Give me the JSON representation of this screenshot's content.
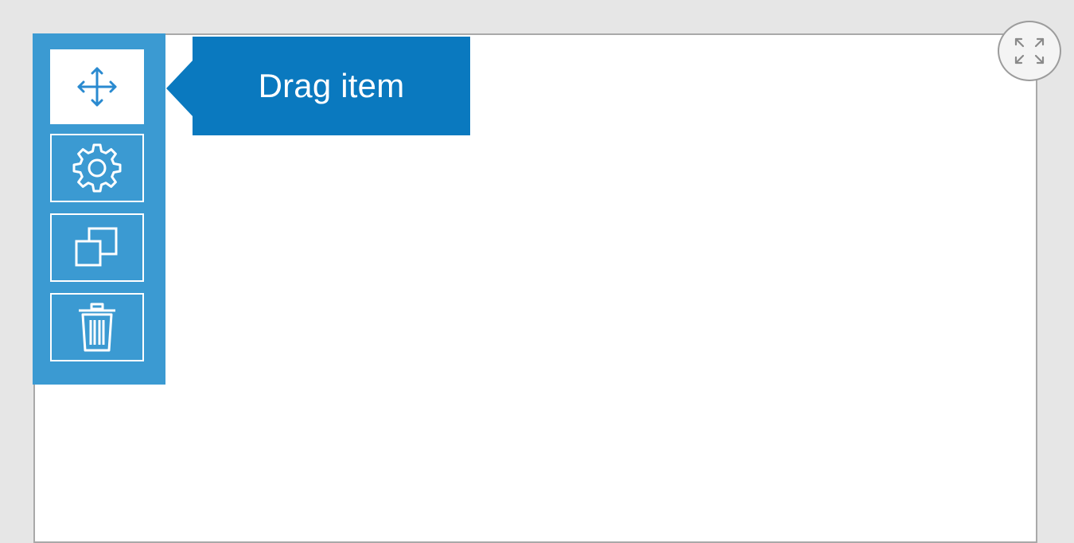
{
  "tooltip": {
    "text": "Drag item"
  },
  "toolbar": {
    "buttons": [
      {
        "name": "drag",
        "icon": "move-arrows-icon",
        "active": true
      },
      {
        "name": "settings",
        "icon": "gear-icon",
        "active": false
      },
      {
        "name": "duplicate",
        "icon": "duplicate-icon",
        "active": false
      },
      {
        "name": "delete",
        "icon": "trash-icon",
        "active": false
      }
    ]
  },
  "fullscreen": {
    "icon": "expand-arrows-icon"
  },
  "colors": {
    "toolbar_bg": "#3b9ad2",
    "tooltip_bg": "#0a79bf",
    "icon_active": "#2a8ad0",
    "page_bg": "#e6e6e6"
  }
}
